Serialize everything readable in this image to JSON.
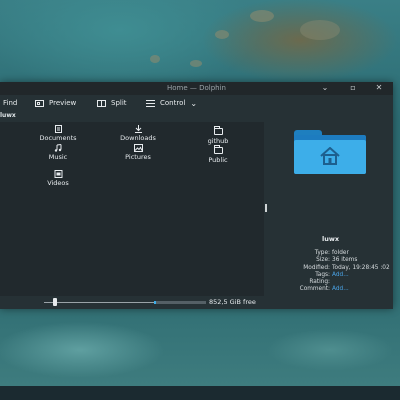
{
  "window": {
    "title": "Home — Dolphin"
  },
  "window_controls": {
    "minimize": "⌄",
    "maximize": "▫",
    "close": "✕"
  },
  "toolbar": {
    "find": "Find",
    "preview": "Preview",
    "split": "Split",
    "control": "Control",
    "control_caret": "⌄"
  },
  "pathbar": {
    "text": "luwx"
  },
  "files": [
    {
      "label": "Documents",
      "icon": "document-folder-icon"
    },
    {
      "label": "Downloads",
      "icon": "download-folder-icon"
    },
    {
      "label": "github",
      "icon": "folder-icon"
    },
    {
      "label": "Music",
      "icon": "music-folder-icon"
    },
    {
      "label": "Pictures",
      "icon": "pictures-folder-icon"
    },
    {
      "label": "Public",
      "icon": "public-folder-icon"
    },
    {
      "label": "Videos",
      "icon": "video-folder-icon"
    }
  ],
  "info_panel": {
    "name": "luwx",
    "icon": "home-folder-icon",
    "properties": [
      {
        "key": "Type:",
        "value": "folder"
      },
      {
        "key": "Size:",
        "value": "36 items"
      },
      {
        "key": "Modified:",
        "value": "Today, 19:28:45 :02"
      },
      {
        "key": "Tags:",
        "value": "Add..."
      },
      {
        "key": "Rating:",
        "value": ""
      },
      {
        "key": "Comment:",
        "value": "Add..."
      }
    ]
  },
  "status": {
    "free_space": "852,5 GiB free",
    "zoom_level": 0.1,
    "space_used_fraction": 0.04
  },
  "colors": {
    "accent": "#3daee9",
    "folder_dark": "#1d7cc0",
    "link": "#4aa3e6"
  }
}
